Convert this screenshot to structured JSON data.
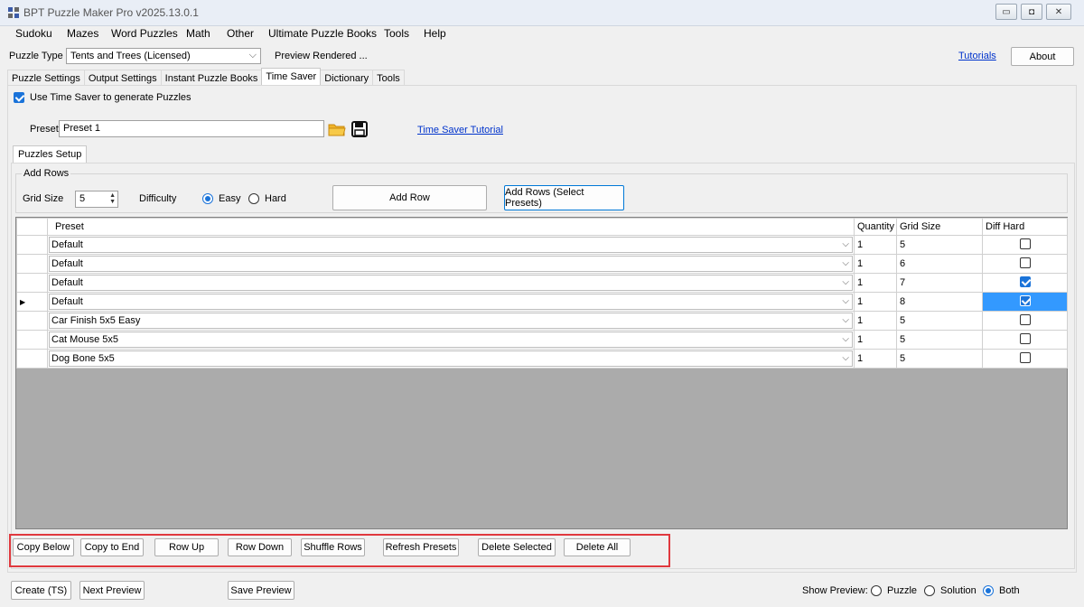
{
  "window": {
    "title": "BPT Puzzle Maker Pro v2025.13.0.1",
    "controls": [
      "minimize",
      "maximize",
      "close"
    ]
  },
  "menu": [
    "Sudoku",
    "Mazes",
    "Word Puzzles",
    "Math",
    "Other",
    "Ultimate Puzzle Books",
    "Tools",
    "Help"
  ],
  "toolbar": {
    "puzzle_type_label": "Puzzle Type",
    "puzzle_type_value": "Tents and Trees (Licensed)",
    "preview_status": "Preview Rendered ...",
    "tutorials_link": "Tutorials",
    "about_button": "About"
  },
  "tabs": [
    "Puzzle Settings",
    "Output Settings",
    "Instant Puzzle Books",
    "Time Saver",
    "Dictionary",
    "Tools"
  ],
  "active_tab": "Time Saver",
  "time_saver": {
    "use_label": "Use Time Saver to generate Puzzles",
    "use_checked": true,
    "preset_label": "Preset",
    "preset_value": "Preset 1",
    "tutorial_link": "Time Saver Tutorial",
    "subtab": "Puzzles Setup",
    "add_rows_group": "Add Rows",
    "grid_size_label": "Grid Size",
    "grid_size_value": "5",
    "difficulty_label": "Difficulty",
    "easy_label": "Easy",
    "hard_label": "Hard",
    "difficulty_selected": "Easy",
    "add_row_button": "Add Row",
    "add_rows_presets_button": "Add Rows (Select Presets)"
  },
  "table": {
    "columns": [
      "Preset",
      "Quantity",
      "Grid Size",
      "Diff Hard"
    ],
    "rows": [
      {
        "preset": "Default",
        "quantity": "1",
        "grid_size": "5",
        "diff_hard": false
      },
      {
        "preset": "Default",
        "quantity": "1",
        "grid_size": "6",
        "diff_hard": false
      },
      {
        "preset": "Default",
        "quantity": "1",
        "grid_size": "7",
        "diff_hard": true
      },
      {
        "preset": "Default",
        "quantity": "1",
        "grid_size": "8",
        "diff_hard": true,
        "current": true
      },
      {
        "preset": "Car Finish 5x5 Easy",
        "quantity": "1",
        "grid_size": "5",
        "diff_hard": false
      },
      {
        "preset": "Cat Mouse 5x5",
        "quantity": "1",
        "grid_size": "5",
        "diff_hard": false
      },
      {
        "preset": "Dog Bone 5x5",
        "quantity": "1",
        "grid_size": "5",
        "diff_hard": false
      }
    ]
  },
  "row_actions": [
    "Copy Below",
    "Copy to End",
    "Row Up",
    "Row Down",
    "Shuffle Rows",
    "Refresh Presets",
    "Delete Selected",
    "Delete All"
  ],
  "footer": {
    "create_button": "Create (TS)",
    "next_preview_button": "Next Preview",
    "save_preview_button": "Save Preview",
    "show_preview_label": "Show Preview:",
    "options": [
      "Puzzle",
      "Solution",
      "Both"
    ],
    "selected": "Both"
  },
  "colors": {
    "accent": "#1a73d9",
    "highlight_border": "#e0393e",
    "grid_empty": "#ababab",
    "link": "#0033cc"
  }
}
